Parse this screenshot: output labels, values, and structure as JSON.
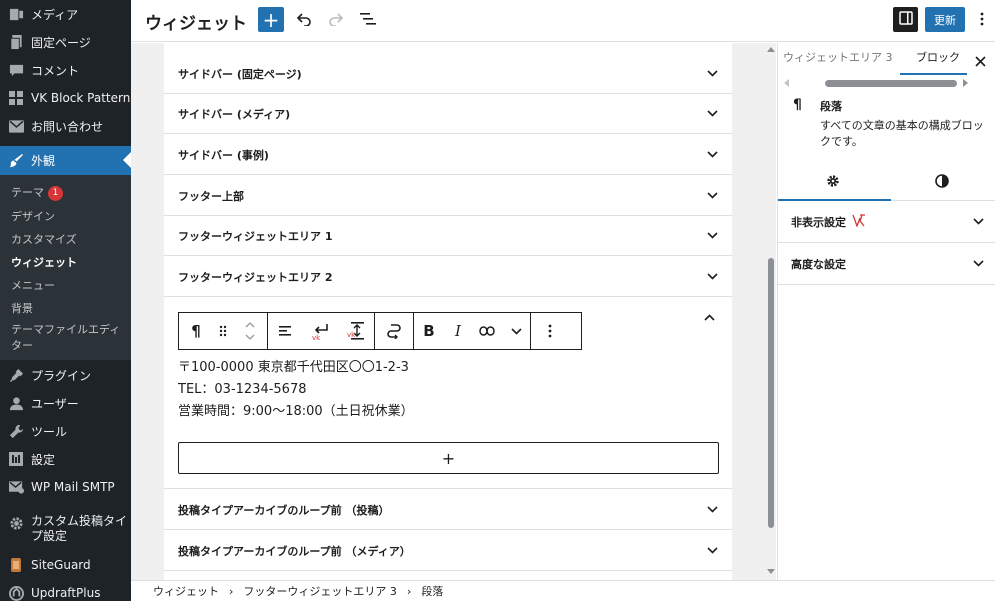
{
  "admin_menu": {
    "items": [
      {
        "label": "メディア",
        "icon": "media-icon"
      },
      {
        "label": "固定ページ",
        "icon": "page-icon"
      },
      {
        "label": "コメント",
        "icon": "comment-icon"
      },
      {
        "label": "VK Block Patterns",
        "icon": "grid-icon"
      },
      {
        "label": "お問い合わせ",
        "icon": "mail-icon"
      },
      {
        "label": "外観",
        "icon": "brush-icon"
      },
      {
        "label": "プラグイン",
        "icon": "plugin-icon"
      },
      {
        "label": "ユーザー",
        "icon": "user-icon"
      },
      {
        "label": "ツール",
        "icon": "wrench-icon"
      },
      {
        "label": "設定",
        "icon": "settings-icon"
      },
      {
        "label": "WP Mail SMTP",
        "icon": "smtp-icon"
      },
      {
        "label": "カスタム投稿タイプ設定",
        "icon": "gear-icon"
      },
      {
        "label": "SiteGuard",
        "icon": "siteguard-icon"
      },
      {
        "label": "UpdraftPlus",
        "icon": "updraft-icon"
      }
    ],
    "submenu": [
      {
        "label": "テーマ",
        "badge": "1"
      },
      {
        "label": "デザイン"
      },
      {
        "label": "カスタマイズ"
      },
      {
        "label": "ウィジェット"
      },
      {
        "label": "メニュー"
      },
      {
        "label": "背景"
      },
      {
        "label": "テーマファイルエディター"
      }
    ]
  },
  "toolbar": {
    "title": "ウィジェット",
    "add_label": "+",
    "update_label": "更新"
  },
  "widget_areas_top": [
    {
      "title": "サイドバー (固定ページ)"
    },
    {
      "title": "サイドバー (メディア)"
    },
    {
      "title": "サイドバー (事例)"
    },
    {
      "title": "フッター上部"
    },
    {
      "title": "フッターウィジェットエリア 1"
    },
    {
      "title": "フッターウィジェットエリア 2"
    }
  ],
  "open_area": {
    "address_lines": [
      "〒100-0000 東京都千代田区〇〇1-2-3",
      "TEL：03-1234-5678",
      "営業時間：9:00〜18:00（土日祝休業）"
    ],
    "add_block_label": "+"
  },
  "widget_areas_bottom": [
    {
      "title": "投稿タイプアーカイブのループ前 （投稿）"
    },
    {
      "title": "投稿タイプアーカイブのループ前 （メディア）"
    }
  ],
  "settings_sidebar": {
    "tab_widget_area": "ウィジェットエリア 3",
    "tab_block": "ブロック",
    "block_name": "段落",
    "block_description": "すべての文章の基本の構成ブロックです。",
    "panels": [
      {
        "title": "非表示設定"
      },
      {
        "title": "高度な設定"
      }
    ]
  },
  "breadcrumb": [
    "ウィジェット",
    "フッターウィジェットエリア 3",
    "段落"
  ],
  "colors": {
    "admin_bg": "#1d2327",
    "accent": "#2271b1",
    "badge": "#d63638",
    "vk_red": "#d63638"
  }
}
